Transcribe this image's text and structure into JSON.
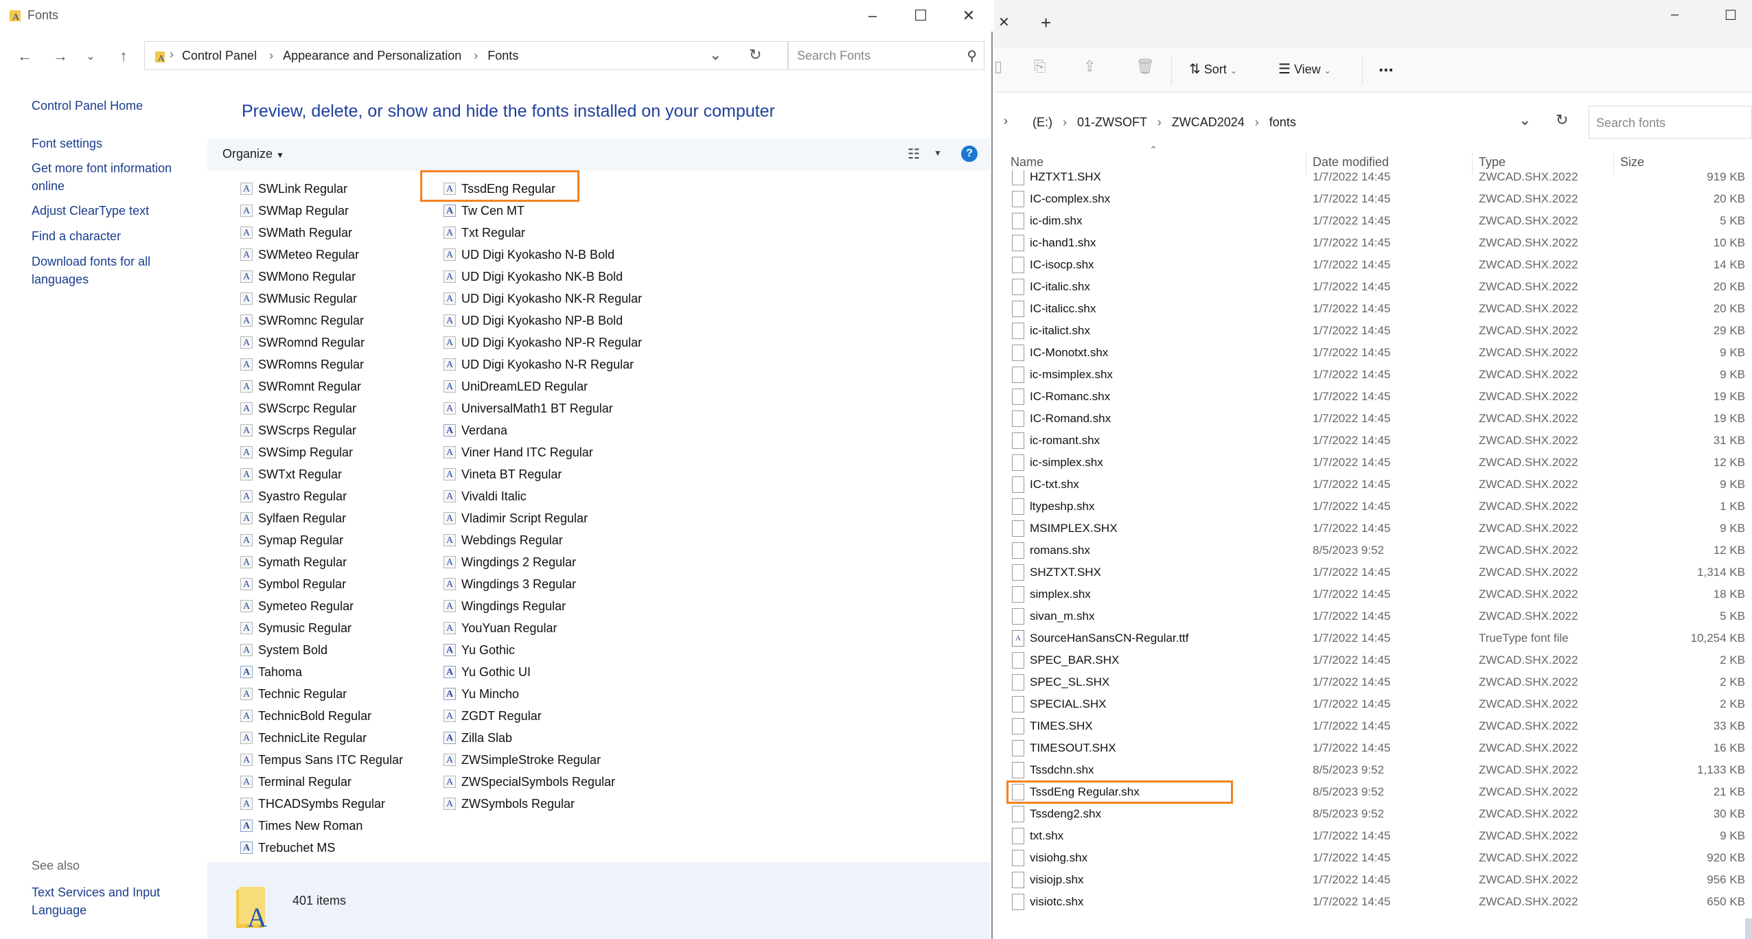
{
  "left_window": {
    "title": "Fonts",
    "breadcrumb": [
      "Control Panel",
      "Appearance and Personalization",
      "Fonts"
    ],
    "search_placeholder": "Search Fonts",
    "nav_links": [
      "Control Panel Home",
      "Font settings",
      "Get more font information online",
      "Adjust ClearType text",
      "Find a character",
      "Download fonts for all languages"
    ],
    "see_also_label": "See also",
    "see_also_links": [
      "Text Services and Input Language"
    ],
    "heading": "Preview, delete, or show and hide the fonts installed on your computer",
    "organize_label": "Organize",
    "fonts_col1": [
      {
        "name": "SWLink Regular",
        "icon": "font-file-icon"
      },
      {
        "name": "SWMap Regular",
        "icon": "font-file-icon"
      },
      {
        "name": "SWMath Regular",
        "icon": "font-file-icon"
      },
      {
        "name": "SWMeteo Regular",
        "icon": "font-file-icon"
      },
      {
        "name": "SWMono Regular",
        "icon": "font-file-icon"
      },
      {
        "name": "SWMusic Regular",
        "icon": "font-file-icon"
      },
      {
        "name": "SWRomnc Regular",
        "icon": "font-file-icon"
      },
      {
        "name": "SWRomnd Regular",
        "icon": "font-file-icon"
      },
      {
        "name": "SWRomns Regular",
        "icon": "font-file-icon"
      },
      {
        "name": "SWRomnt Regular",
        "icon": "font-file-icon"
      },
      {
        "name": "SWScrpc Regular",
        "icon": "font-file-icon"
      },
      {
        "name": "SWScrps Regular",
        "icon": "font-file-icon"
      },
      {
        "name": "SWSimp Regular",
        "icon": "font-file-icon"
      },
      {
        "name": "SWTxt Regular",
        "icon": "font-file-icon"
      },
      {
        "name": "Syastro Regular",
        "icon": "font-file-icon"
      },
      {
        "name": "Sylfaen Regular",
        "icon": "font-file-icon"
      },
      {
        "name": "Symap Regular",
        "icon": "font-file-icon"
      },
      {
        "name": "Symath Regular",
        "icon": "font-file-icon"
      },
      {
        "name": "Symbol Regular",
        "icon": "font-file-icon"
      },
      {
        "name": "Symeteo Regular",
        "icon": "font-file-icon"
      },
      {
        "name": "Symusic Regular",
        "icon": "font-file-icon"
      },
      {
        "name": "System Bold",
        "icon": "font-file-icon"
      },
      {
        "name": "Tahoma",
        "icon": "font-family-icon"
      },
      {
        "name": "Technic Regular",
        "icon": "font-file-icon"
      },
      {
        "name": "TechnicBold Regular",
        "icon": "font-file-icon"
      },
      {
        "name": "TechnicLite Regular",
        "icon": "font-file-icon"
      },
      {
        "name": "Tempus Sans ITC Regular",
        "icon": "font-file-icon"
      },
      {
        "name": "Terminal Regular",
        "icon": "font-file-icon"
      },
      {
        "name": "THCADSymbs Regular",
        "icon": "font-file-icon"
      },
      {
        "name": "Times New Roman",
        "icon": "font-family-icon"
      },
      {
        "name": "Trebuchet MS",
        "icon": "font-family-icon"
      }
    ],
    "fonts_col2": [
      {
        "name": "TssdEng Regular",
        "icon": "font-file-icon"
      },
      {
        "name": "Tw Cen MT",
        "icon": "font-family-icon"
      },
      {
        "name": "Txt Regular",
        "icon": "font-file-icon"
      },
      {
        "name": "UD Digi Kyokasho N-B Bold",
        "icon": "font-file-icon"
      },
      {
        "name": "UD Digi Kyokasho NK-B Bold",
        "icon": "font-file-icon"
      },
      {
        "name": "UD Digi Kyokasho NK-R Regular",
        "icon": "font-file-icon"
      },
      {
        "name": "UD Digi Kyokasho NP-B Bold",
        "icon": "font-file-icon"
      },
      {
        "name": "UD Digi Kyokasho NP-R Regular",
        "icon": "font-file-icon"
      },
      {
        "name": "UD Digi Kyokasho N-R Regular",
        "icon": "font-file-icon"
      },
      {
        "name": "UniDreamLED Regular",
        "icon": "font-file-icon"
      },
      {
        "name": "UniversalMath1 BT Regular",
        "icon": "font-file-icon"
      },
      {
        "name": "Verdana",
        "icon": "font-family-icon"
      },
      {
        "name": "Viner Hand ITC Regular",
        "icon": "font-file-icon"
      },
      {
        "name": "Vineta BT Regular",
        "icon": "font-file-icon"
      },
      {
        "name": "Vivaldi Italic",
        "icon": "font-file-icon"
      },
      {
        "name": "Vladimir Script Regular",
        "icon": "font-file-icon"
      },
      {
        "name": "Webdings Regular",
        "icon": "font-file-icon"
      },
      {
        "name": "Wingdings 2 Regular",
        "icon": "font-file-icon"
      },
      {
        "name": "Wingdings 3 Regular",
        "icon": "font-file-icon"
      },
      {
        "name": "Wingdings Regular",
        "icon": "font-file-icon"
      },
      {
        "name": "YouYuan Regular",
        "icon": "font-file-icon"
      },
      {
        "name": "Yu Gothic",
        "icon": "font-family-icon"
      },
      {
        "name": "Yu Gothic UI",
        "icon": "font-family-icon"
      },
      {
        "name": "Yu Mincho",
        "icon": "font-family-icon"
      },
      {
        "name": "ZGDT Regular",
        "icon": "font-file-icon"
      },
      {
        "name": "Zilla Slab",
        "icon": "font-family-icon"
      },
      {
        "name": "ZWSimpleStroke Regular",
        "icon": "font-file-icon"
      },
      {
        "name": "ZWSpecialSymbols Regular",
        "icon": "font-file-icon"
      },
      {
        "name": "ZWSymbols Regular",
        "icon": "font-file-icon"
      }
    ],
    "highlighted_font": "TssdEng Regular",
    "status_count": "401 items"
  },
  "right_window": {
    "breadcrumb": [
      "(E:)",
      "01-ZWSOFT",
      "ZWCAD2024",
      "fonts"
    ],
    "search_placeholder": "Search fonts",
    "sort_label": "Sort",
    "view_label": "View",
    "more_label": "...",
    "columns": [
      "Name",
      "Date modified",
      "Type",
      "Size"
    ],
    "files": [
      {
        "name": "HZTXT1.SHX",
        "date": "1/7/2022 14:45",
        "type": "ZWCAD.SHX.2022",
        "size": "919 KB",
        "ttf": false
      },
      {
        "name": "IC-complex.shx",
        "date": "1/7/2022 14:45",
        "type": "ZWCAD.SHX.2022",
        "size": "20 KB",
        "ttf": false
      },
      {
        "name": "ic-dim.shx",
        "date": "1/7/2022 14:45",
        "type": "ZWCAD.SHX.2022",
        "size": "5 KB",
        "ttf": false
      },
      {
        "name": "ic-hand1.shx",
        "date": "1/7/2022 14:45",
        "type": "ZWCAD.SHX.2022",
        "size": "10 KB",
        "ttf": false
      },
      {
        "name": "IC-isocp.shx",
        "date": "1/7/2022 14:45",
        "type": "ZWCAD.SHX.2022",
        "size": "14 KB",
        "ttf": false
      },
      {
        "name": "IC-italic.shx",
        "date": "1/7/2022 14:45",
        "type": "ZWCAD.SHX.2022",
        "size": "20 KB",
        "ttf": false
      },
      {
        "name": "IC-italicc.shx",
        "date": "1/7/2022 14:45",
        "type": "ZWCAD.SHX.2022",
        "size": "20 KB",
        "ttf": false
      },
      {
        "name": "ic-italict.shx",
        "date": "1/7/2022 14:45",
        "type": "ZWCAD.SHX.2022",
        "size": "29 KB",
        "ttf": false
      },
      {
        "name": "IC-Monotxt.shx",
        "date": "1/7/2022 14:45",
        "type": "ZWCAD.SHX.2022",
        "size": "9 KB",
        "ttf": false
      },
      {
        "name": "ic-msimplex.shx",
        "date": "1/7/2022 14:45",
        "type": "ZWCAD.SHX.2022",
        "size": "9 KB",
        "ttf": false
      },
      {
        "name": "IC-Romanc.shx",
        "date": "1/7/2022 14:45",
        "type": "ZWCAD.SHX.2022",
        "size": "19 KB",
        "ttf": false
      },
      {
        "name": "IC-Romand.shx",
        "date": "1/7/2022 14:45",
        "type": "ZWCAD.SHX.2022",
        "size": "19 KB",
        "ttf": false
      },
      {
        "name": "ic-romant.shx",
        "date": "1/7/2022 14:45",
        "type": "ZWCAD.SHX.2022",
        "size": "31 KB",
        "ttf": false
      },
      {
        "name": "ic-simplex.shx",
        "date": "1/7/2022 14:45",
        "type": "ZWCAD.SHX.2022",
        "size": "12 KB",
        "ttf": false
      },
      {
        "name": "IC-txt.shx",
        "date": "1/7/2022 14:45",
        "type": "ZWCAD.SHX.2022",
        "size": "9 KB",
        "ttf": false
      },
      {
        "name": "ltypeshp.shx",
        "date": "1/7/2022 14:45",
        "type": "ZWCAD.SHX.2022",
        "size": "1 KB",
        "ttf": false
      },
      {
        "name": "MSIMPLEX.SHX",
        "date": "1/7/2022 14:45",
        "type": "ZWCAD.SHX.2022",
        "size": "9 KB",
        "ttf": false
      },
      {
        "name": "romans.shx",
        "date": "8/5/2023 9:52",
        "type": "ZWCAD.SHX.2022",
        "size": "12 KB",
        "ttf": false
      },
      {
        "name": "SHZTXT.SHX",
        "date": "1/7/2022 14:45",
        "type": "ZWCAD.SHX.2022",
        "size": "1,314 KB",
        "ttf": false
      },
      {
        "name": "simplex.shx",
        "date": "1/7/2022 14:45",
        "type": "ZWCAD.SHX.2022",
        "size": "18 KB",
        "ttf": false
      },
      {
        "name": "sivan_m.shx",
        "date": "1/7/2022 14:45",
        "type": "ZWCAD.SHX.2022",
        "size": "5 KB",
        "ttf": false
      },
      {
        "name": "SourceHanSansCN-Regular.ttf",
        "date": "1/7/2022 14:45",
        "type": "TrueType font file",
        "size": "10,254 KB",
        "ttf": true
      },
      {
        "name": "SPEC_BAR.SHX",
        "date": "1/7/2022 14:45",
        "type": "ZWCAD.SHX.2022",
        "size": "2 KB",
        "ttf": false
      },
      {
        "name": "SPEC_SL.SHX",
        "date": "1/7/2022 14:45",
        "type": "ZWCAD.SHX.2022",
        "size": "2 KB",
        "ttf": false
      },
      {
        "name": "SPECIAL.SHX",
        "date": "1/7/2022 14:45",
        "type": "ZWCAD.SHX.2022",
        "size": "2 KB",
        "ttf": false
      },
      {
        "name": "TIMES.SHX",
        "date": "1/7/2022 14:45",
        "type": "ZWCAD.SHX.2022",
        "size": "33 KB",
        "ttf": false
      },
      {
        "name": "TIMESOUT.SHX",
        "date": "1/7/2022 14:45",
        "type": "ZWCAD.SHX.2022",
        "size": "16 KB",
        "ttf": false
      },
      {
        "name": "Tssdchn.shx",
        "date": "8/5/2023 9:52",
        "type": "ZWCAD.SHX.2022",
        "size": "1,133 KB",
        "ttf": false
      },
      {
        "name": "TssdEng Regular.shx",
        "date": "8/5/2023 9:52",
        "type": "ZWCAD.SHX.2022",
        "size": "21 KB",
        "ttf": false
      },
      {
        "name": "Tssdeng2.shx",
        "date": "8/5/2023 9:52",
        "type": "ZWCAD.SHX.2022",
        "size": "30 KB",
        "ttf": false
      },
      {
        "name": "txt.shx",
        "date": "1/7/2022 14:45",
        "type": "ZWCAD.SHX.2022",
        "size": "9 KB",
        "ttf": false
      },
      {
        "name": "visiohg.shx",
        "date": "1/7/2022 14:45",
        "type": "ZWCAD.SHX.2022",
        "size": "920 KB",
        "ttf": false
      },
      {
        "name": "visiojp.shx",
        "date": "1/7/2022 14:45",
        "type": "ZWCAD.SHX.2022",
        "size": "956 KB",
        "ttf": false
      },
      {
        "name": "visiotc.shx",
        "date": "1/7/2022 14:45",
        "type": "ZWCAD.SHX.2022",
        "size": "650 KB",
        "ttf": false
      }
    ],
    "highlighted_file": "TssdEng Regular.shx"
  },
  "colors": {
    "highlight": "#f5821f",
    "link": "#1a3d8f",
    "heading": "#1e3f9e"
  }
}
